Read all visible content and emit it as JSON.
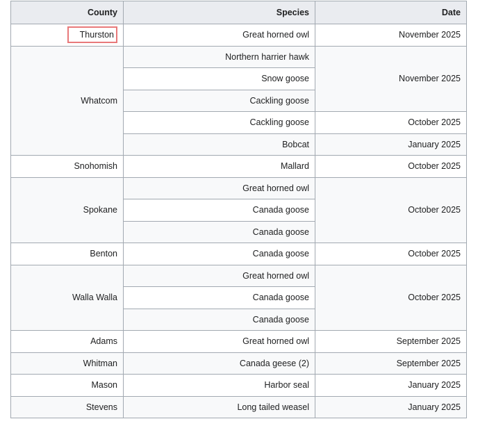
{
  "table": {
    "headers": [
      "County",
      "Species",
      "Date"
    ],
    "rows": [
      {
        "county": "Thurston",
        "species": "Great horned owl",
        "date": "November 2025"
      },
      {
        "county": "Whatcom",
        "species": "Northern harrier hawk",
        "date": "November 2025"
      },
      {
        "species": "Snow goose"
      },
      {
        "species": "Cackling goose"
      },
      {
        "species": "Cackling goose",
        "date": "October 2025"
      },
      {
        "species": "Bobcat",
        "date": "January 2025"
      },
      {
        "county": "Snohomish",
        "species": "Mallard",
        "date": "October 2025"
      },
      {
        "county": "Spokane",
        "species": "Great horned owl",
        "date": "October 2025"
      },
      {
        "species": "Canada goose"
      },
      {
        "species": "Canada goose"
      },
      {
        "county": "Benton",
        "species": "Canada goose",
        "date": "October 2025"
      },
      {
        "county": "Walla Walla",
        "species": "Great horned owl",
        "date": "October 2025"
      },
      {
        "species": "Canada goose"
      },
      {
        "species": "Canada goose"
      },
      {
        "county": "Adams",
        "species": "Great horned owl",
        "date": "September 2025"
      },
      {
        "county": "Whitman",
        "species": "Canada geese (2)",
        "date": "September 2025"
      },
      {
        "county": "Mason",
        "species": "Harbor seal",
        "date": "January 2025"
      },
      {
        "county": "Stevens",
        "species": "Long tailed weasel",
        "date": "January 2025"
      }
    ]
  },
  "highlight": {
    "color": "#e8797a"
  }
}
